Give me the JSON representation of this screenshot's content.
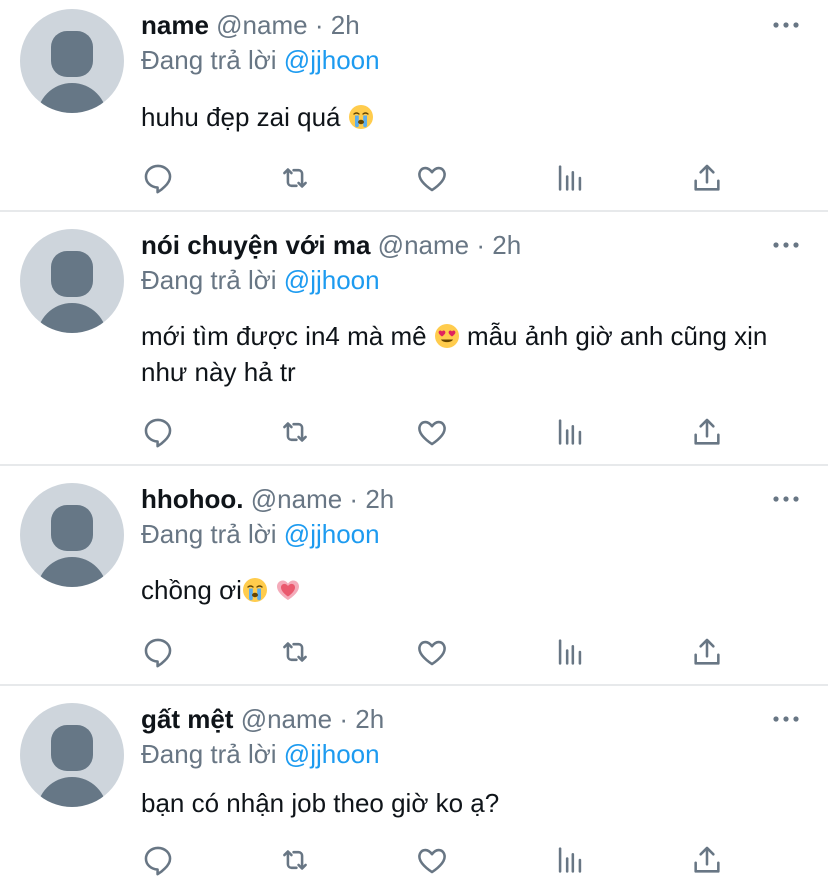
{
  "tweets": [
    {
      "display_name": "name",
      "handle": "@name",
      "dot": "·",
      "time": "2h",
      "replying_prefix": "Đang trả lời",
      "replying_to": "@jjhoon",
      "text": "huhu đẹp zai quá",
      "emoji": [
        "crying-face"
      ]
    },
    {
      "display_name": "nói chuyện với ma",
      "handle": "@name",
      "dot": "·",
      "time": "2h",
      "replying_prefix": "Đang trả lời",
      "replying_to": "@jjhoon",
      "text_part1": "mới tìm được in4 mà mê",
      "text_part2": " mẫu ảnh giờ anh cũng xịn như này hả tr",
      "emoji": [
        "heart-eyes-face"
      ]
    },
    {
      "display_name": "hhohoo.",
      "handle": "@name",
      "dot": "·",
      "time": "2h",
      "replying_prefix": "Đang trả lời",
      "replying_to": "@jjhoon",
      "text": "chồng ơi",
      "emoji": [
        "crying-face",
        "pink-heart"
      ]
    },
    {
      "display_name": "gất mệt",
      "handle": "@name",
      "dot": "·",
      "time": "2h",
      "replying_prefix": "Đang trả lời",
      "replying_to": "@jjhoon",
      "text": "bạn có nhận job theo giờ ko ạ?",
      "emoji": []
    }
  ],
  "colors": {
    "text": "#0f1419",
    "secondary": "#687684",
    "link": "#1d9bf0",
    "avatar_bg": "#ced5dc",
    "avatar_fg": "#667786",
    "divider": "#e7e9eb"
  },
  "action_icons": [
    "reply-icon",
    "retweet-icon",
    "like-icon",
    "analytics-icon",
    "share-icon"
  ]
}
